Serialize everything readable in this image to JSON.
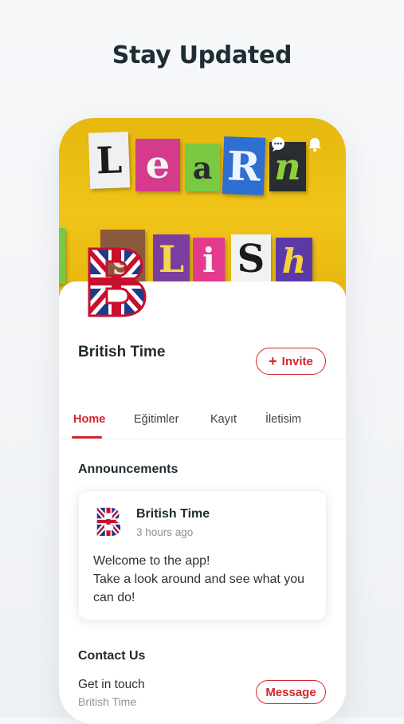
{
  "headline": "Stay Updated",
  "cover": {
    "row1_letters": [
      "L",
      "e",
      "a",
      "R",
      "n"
    ],
    "row2_letters": [
      "g",
      "L",
      "i",
      "S",
      "h"
    ],
    "icons": [
      "chat-bubble-icon",
      "bell-icon"
    ]
  },
  "profile": {
    "name": "British Time",
    "logo_letter": "B",
    "invite_label": "Invite",
    "invite_icon": "+"
  },
  "tabs": [
    {
      "label": "Home",
      "active": true
    },
    {
      "label": "Eğitimler",
      "active": false
    },
    {
      "label": "Kayıt",
      "active": false
    },
    {
      "label": "İletisim",
      "active": false
    }
  ],
  "announcements": {
    "title": "Announcements",
    "post": {
      "author": "British Time",
      "time": "3 hours ago",
      "line1": "Welcome to the app!",
      "line2": "Take a look around and see what you can do!"
    }
  },
  "contact": {
    "title": "Contact Us",
    "primary": "Get in touch",
    "secondary": "British Time",
    "button_label": "Message"
  },
  "colors": {
    "accent": "#d3262d",
    "cover_yellow": "#f1c419",
    "text_dark": "#1f2a30",
    "text_muted": "#8a9296"
  }
}
